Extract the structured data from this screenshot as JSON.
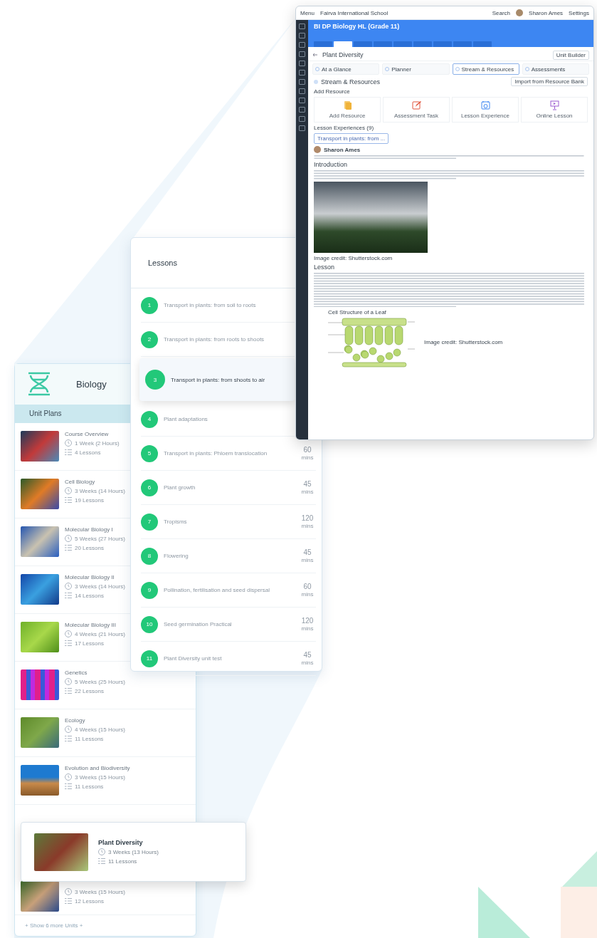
{
  "app_window": {
    "top_bar": {
      "menu": "Menu",
      "school": "Fairva International School",
      "search": "Search",
      "user": "Sharon Ames",
      "settings": "Settings"
    },
    "course_title": "BI DP Biology HL (Grade 11)",
    "tabs": [
      {
        "selected": false
      },
      {
        "selected": true
      },
      {
        "selected": false
      },
      {
        "selected": false
      },
      {
        "selected": false
      },
      {
        "selected": false
      },
      {
        "selected": false
      },
      {
        "selected": false
      },
      {
        "selected": false
      }
    ],
    "unit_title": "Plant Diversity",
    "builder_button": "Unit Builder",
    "sections": [
      {
        "label": "At a Glance",
        "selected": false
      },
      {
        "label": "Planner",
        "selected": false
      },
      {
        "label": "Stream & Resources",
        "selected": true
      },
      {
        "label": "Assessments",
        "selected": false
      }
    ],
    "stream_heading": "Stream & Resources",
    "import_button": "Import from Resource Bank",
    "add_resource": "Add Resource",
    "resource_cards": [
      {
        "kind": "file",
        "label": "Add Resource"
      },
      {
        "kind": "task",
        "label": "Assessment Task"
      },
      {
        "kind": "lesson",
        "label": "Lesson Experience"
      },
      {
        "kind": "online",
        "label": "Online Lesson"
      }
    ],
    "experiences_label": "Lesson Experiences (9)",
    "experience_select": "Transport in plants: from ...",
    "post": {
      "author": "Sharon Ames",
      "intro_heading": "Introduction",
      "image_credit": "Image credit: Shutterstock.com",
      "lesson_heading": "Lesson",
      "diagram_title": "Cell Structure of a Leaf",
      "diagram_credit": "Image credit: Shutterstock.com"
    }
  },
  "lessons_panel": {
    "title": "Lessons",
    "lessons": [
      {
        "number": "1",
        "title": "Transport in plants: from soil to roots",
        "selected": false
      },
      {
        "number": "2",
        "title": "Transport in plants: from roots to shoots",
        "selected": false
      },
      {
        "number": "3",
        "title": "Transport in plants: from shoots to air",
        "selected": true
      },
      {
        "number": "4",
        "title": "Plant adaptations",
        "selected": false
      },
      {
        "number": "5",
        "title": "Transport in plants: Phloem translocation",
        "duration": "60",
        "unit": "mins",
        "selected": false
      },
      {
        "number": "6",
        "title": "Plant growth",
        "duration": "45",
        "unit": "mins",
        "selected": false
      },
      {
        "number": "7",
        "title": "Tropisms",
        "duration": "120",
        "unit": "mins",
        "selected": false
      },
      {
        "number": "8",
        "title": "Flowering",
        "duration": "45",
        "unit": "mins",
        "selected": false
      },
      {
        "number": "9",
        "title": "Pollination, fertilisation and seed dispersal",
        "duration": "60",
        "unit": "mins",
        "selected": false
      },
      {
        "number": "10",
        "title": "Seed germination Practical",
        "duration": "120",
        "unit": "mins",
        "selected": false
      },
      {
        "number": "11",
        "title": "Plant Diversity unit test",
        "duration": "45",
        "unit": "mins",
        "selected": false
      }
    ]
  },
  "units_panel": {
    "subject": "Biology",
    "heading": "Unit Plans",
    "units": [
      {
        "title": "Course Overview",
        "duration": "1 Week (2 Hours)",
        "lessons": "4 Lessons",
        "selected": false
      },
      {
        "title": "Cell Biology",
        "duration": "3 Weeks (14 Hours)",
        "lessons": "19 Lessons",
        "selected": false
      },
      {
        "title": "Molecular Biology I",
        "duration": "5 Weeks (27 Hours)",
        "lessons": "20 Lessons",
        "selected": false
      },
      {
        "title": "Molecular Biology II",
        "duration": "3 Weeks (14 Hours)",
        "lessons": "14 Lessons",
        "selected": false
      },
      {
        "title": "Molecular Biology III",
        "duration": "4 Weeks (21 Hours)",
        "lessons": "17 Lessons",
        "selected": false
      },
      {
        "title": "Genetics",
        "duration": "5 Weeks (25 Hours)",
        "lessons": "22 Lessons",
        "selected": false
      },
      {
        "title": "Ecology",
        "duration": "4 Weeks (15 Hours)",
        "lessons": "11 Lessons",
        "selected": false
      },
      {
        "title": "Evolution and Biodiversity",
        "duration": "3 Weeks (15 Hours)",
        "lessons": "11 Lessons",
        "selected": false
      },
      {
        "title": "Plant Diversity",
        "duration": "3 Weeks (13 Hours)",
        "lessons": "11 Lessons",
        "selected": true
      },
      {
        "duration": "3 Weeks (15 Hours)",
        "lessons": "12 Lessons",
        "selected": false
      }
    ],
    "show_more": "+ Show 6 more Units +"
  }
}
